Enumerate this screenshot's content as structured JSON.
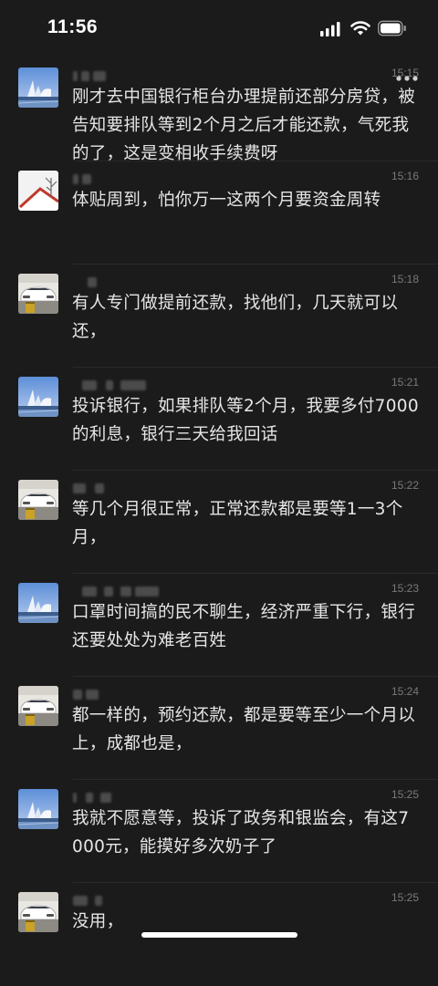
{
  "status_bar": {
    "time": "11:56"
  },
  "icons": {
    "signal": "signal-icon",
    "wifi": "wifi-icon",
    "battery": "battery-icon",
    "more": "more-icon"
  },
  "comments": [
    {
      "time": "15:15",
      "text": "刚才去中国银行柜台办理提前还部分房贷，被告知要排队等到2个月之后才能还款，气死我的了，这是变相收手续费呀",
      "avatar": "city-skyline"
    },
    {
      "time": "15:16",
      "text": "体贴周到，怕你万一这两个月要资金周转",
      "avatar": "roof-tree"
    },
    {
      "time": "15:18",
      "text": "有人专门做提前还款，找他们，几天就可以还，",
      "avatar": "white-car"
    },
    {
      "time": "15:21",
      "text": "投诉银行，如果排队等2个月，我要多付7000的利息，银行三天给我回话",
      "avatar": "city-skyline"
    },
    {
      "time": "15:22",
      "text": "等几个月很正常，正常还款都是要等1一3个月，",
      "avatar": "white-car"
    },
    {
      "time": "15:23",
      "text": "口罩时间搞的民不聊生，经济严重下行，银行还要处处为难老百姓",
      "avatar": "city-skyline"
    },
    {
      "time": "15:24",
      "text": "都一样的，预约还款，都是要等至少一个月以上，成都也是，",
      "avatar": "white-car"
    },
    {
      "time": "15:25",
      "text": "我就不愿意等，投诉了政务和银监会，有这7000元，能摸好多次奶子了",
      "avatar": "city-skyline"
    },
    {
      "time": "15:25",
      "text": "没用，",
      "avatar": "white-car"
    }
  ],
  "colors": {
    "background": "#1b1b1b",
    "text": "#e6e6e6",
    "timestamp": "#7a7a7a"
  }
}
